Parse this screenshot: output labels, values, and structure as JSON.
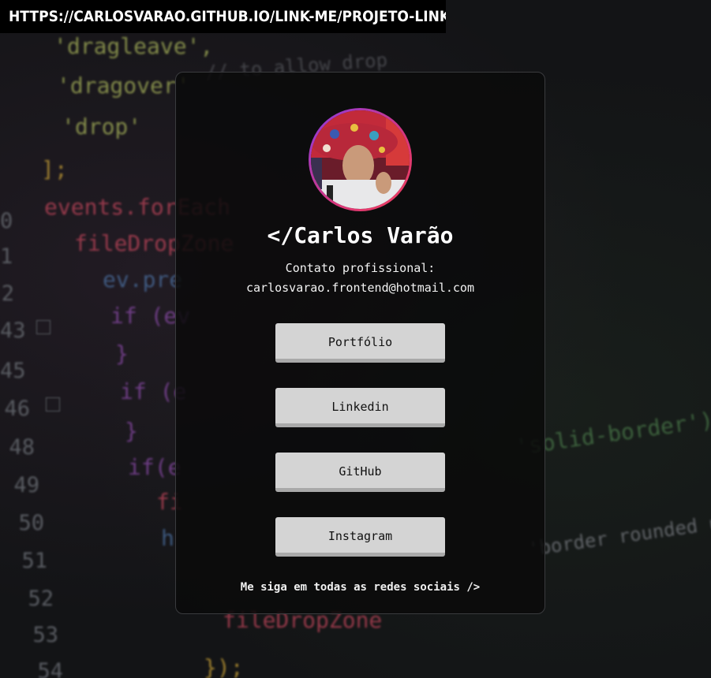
{
  "browser": {
    "url": "HTTPS://CARLOSVARAO.GITHUB.IO/LINK-ME/PROJETO-LINKME/INDEX.HTML"
  },
  "profile": {
    "name": "</Carlos Varão",
    "contact_label": "Contato profissional:",
    "contact_email": "carlosvarao.frontend@hotmail.com"
  },
  "links": [
    {
      "label": "Portfólio"
    },
    {
      "label": "Linkedin"
    },
    {
      "label": "GitHub"
    },
    {
      "label": "Instagram"
    }
  ],
  "footer": {
    "text": "Me siga em todas as redes sociais />"
  },
  "background_code": {
    "line_numbers": [
      "0",
      "1",
      "2",
      "43",
      "45",
      "46",
      "48",
      "49",
      "50",
      "51",
      "52",
      "53",
      "54"
    ],
    "lines": [
      "'dragleave',",
      "'dragover'",
      "'drop'",
      "];",
      "events.forEach",
      "fileDropZone",
      "ev.pre",
      "if (ev",
      "}",
      "if (e",
      "}",
      "if(e",
      "fi",
      "h",
      "fileDropZone",
      "});",
      "'solid-border');",
      "'border rounded ung",
      "// to allow drop"
    ]
  },
  "colors": {
    "card_border": "#3a3b3e",
    "button_bg": "#d4d4d4",
    "avatar_ring_start": "#8a3be0",
    "avatar_ring_end": "#f0405c"
  }
}
